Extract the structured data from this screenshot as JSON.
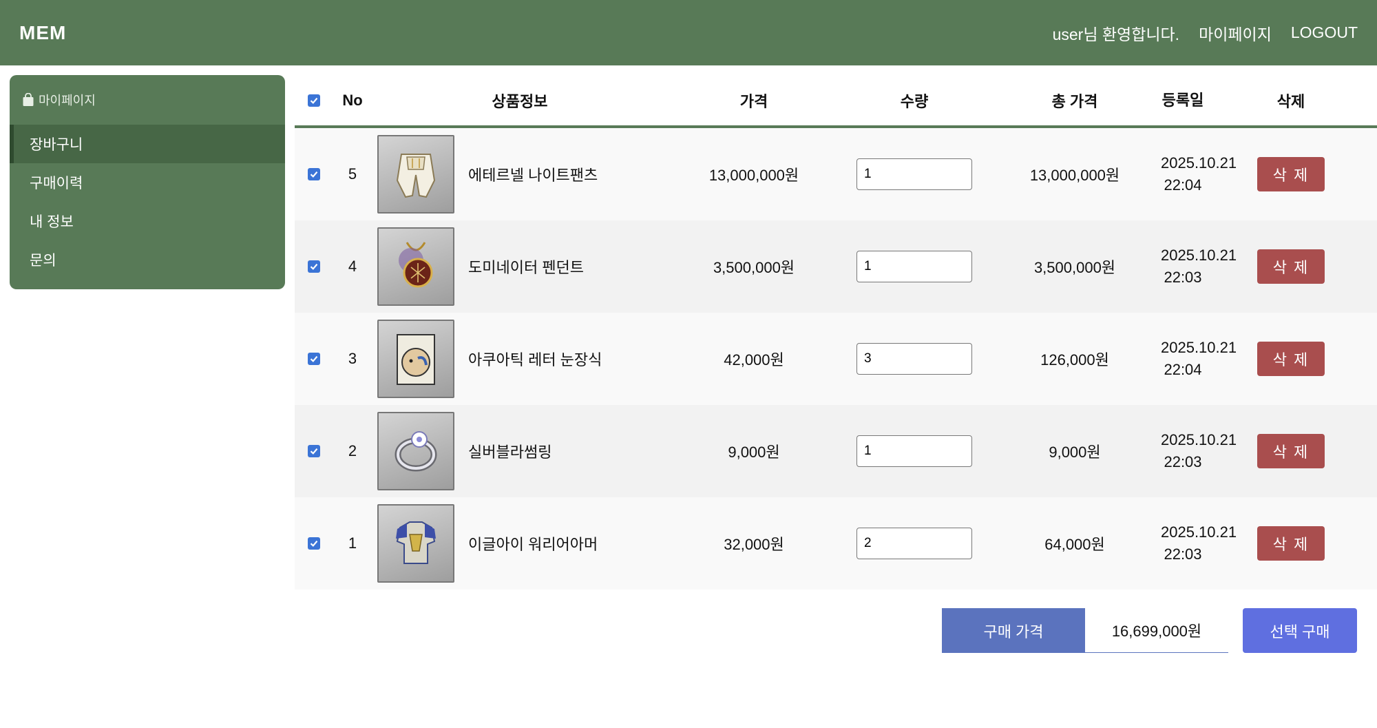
{
  "header": {
    "logo": "MEM",
    "welcome": "user님 환영합니다.",
    "mypage_link": "마이페이지",
    "logout_link": "LOGOUT"
  },
  "sidebar": {
    "title": "마이페이지",
    "items": [
      {
        "label": "장바구니",
        "active": true
      },
      {
        "label": "구매이력",
        "active": false
      },
      {
        "label": "내 정보",
        "active": false
      },
      {
        "label": "문의",
        "active": false
      }
    ]
  },
  "table": {
    "headers": {
      "no": "No",
      "info": "상품정보",
      "price": "가격",
      "qty": "수량",
      "total": "총 가격",
      "date": "등록일",
      "delete": "삭제"
    },
    "rows": [
      {
        "no": "5",
        "name": "에테르넬 나이트팬츠",
        "price": "13,000,000원",
        "qty": "1",
        "total": "13,000,000원",
        "date": "2025.10.21",
        "time": "22:04",
        "delete_label": "삭 제",
        "icon": "pants-icon"
      },
      {
        "no": "4",
        "name": "도미네이터 펜던트",
        "price": "3,500,000원",
        "qty": "1",
        "total": "3,500,000원",
        "date": "2025.10.21",
        "time": "22:03",
        "delete_label": "삭 제",
        "icon": "pendant-icon"
      },
      {
        "no": "3",
        "name": "아쿠아틱 레터 눈장식",
        "price": "42,000원",
        "qty": "3",
        "total": "126,000원",
        "date": "2025.10.21",
        "time": "22:04",
        "delete_label": "삭 제",
        "icon": "eye-accessory-icon"
      },
      {
        "no": "2",
        "name": "실버블라썸링",
        "price": "9,000원",
        "qty": "1",
        "total": "9,000원",
        "date": "2025.10.21",
        "time": "22:03",
        "delete_label": "삭 제",
        "icon": "ring-icon"
      },
      {
        "no": "1",
        "name": "이글아이 워리어아머",
        "price": "32,000원",
        "qty": "2",
        "total": "64,000원",
        "date": "2025.10.21",
        "time": "22:03",
        "delete_label": "삭 제",
        "icon": "armor-icon"
      }
    ]
  },
  "footer": {
    "purchase_price_label": "구매 가격",
    "purchase_price_value": "16,699,000원",
    "buy_selected_label": "선택 구매"
  },
  "colors": {
    "header": "#587a57",
    "delete_button": "#a94e4e",
    "buy_button": "#5f6fe0",
    "price_label": "#5b73be"
  }
}
